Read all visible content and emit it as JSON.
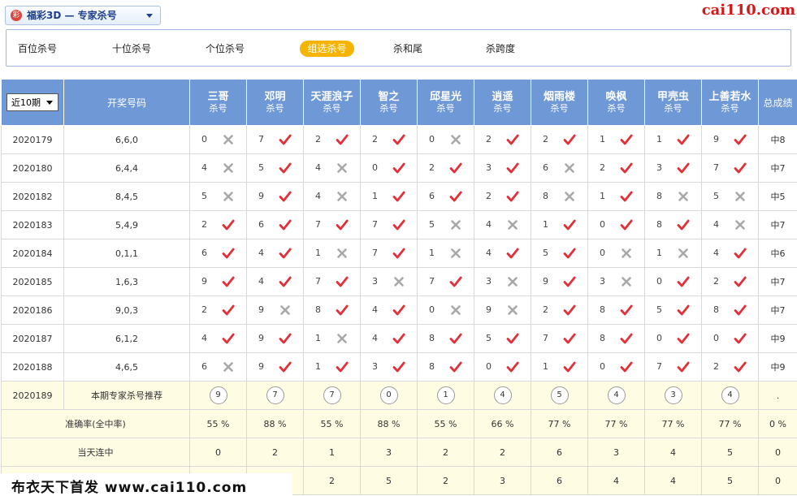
{
  "header": {
    "lottery_select": "福彩3D — 专家杀号",
    "logo_text": "彩",
    "site": "cai110.com"
  },
  "tabs": [
    {
      "label": "百位杀号",
      "active": false
    },
    {
      "label": "十位杀号",
      "active": false
    },
    {
      "label": "个位杀号",
      "active": false
    },
    {
      "label": "组选杀号",
      "active": true
    },
    {
      "label": "杀和尾",
      "active": false
    },
    {
      "label": "杀跨度",
      "active": false
    }
  ],
  "table": {
    "period_select": "近10期",
    "draw_col": "开奖号码",
    "total_col": "总成绩",
    "experts": [
      {
        "name": "三哥",
        "sub": "杀号"
      },
      {
        "name": "邓明",
        "sub": "杀号"
      },
      {
        "name": "天涯浪子",
        "sub": "杀号"
      },
      {
        "name": "智之",
        "sub": "杀号"
      },
      {
        "name": "邱星光",
        "sub": "杀号"
      },
      {
        "name": "逍遥",
        "sub": "杀号"
      },
      {
        "name": "烟雨楼",
        "sub": "杀号"
      },
      {
        "name": "唤枫",
        "sub": "杀号"
      },
      {
        "name": "甲壳虫",
        "sub": "杀号"
      },
      {
        "name": "上善若水",
        "sub": "杀号"
      }
    ],
    "rows": [
      {
        "period": "2020179",
        "draw": "6,6,0",
        "picks": [
          [
            "0",
            "x"
          ],
          [
            "7",
            "v"
          ],
          [
            "2",
            "v"
          ],
          [
            "2",
            "v"
          ],
          [
            "0",
            "x"
          ],
          [
            "2",
            "v"
          ],
          [
            "2",
            "v"
          ],
          [
            "1",
            "v"
          ],
          [
            "1",
            "v"
          ],
          [
            "9",
            "v"
          ]
        ],
        "total": "中8"
      },
      {
        "period": "2020180",
        "draw": "6,4,4",
        "picks": [
          [
            "4",
            "x"
          ],
          [
            "5",
            "v"
          ],
          [
            "4",
            "x"
          ],
          [
            "0",
            "v"
          ],
          [
            "2",
            "v"
          ],
          [
            "3",
            "v"
          ],
          [
            "6",
            "x"
          ],
          [
            "2",
            "v"
          ],
          [
            "3",
            "v"
          ],
          [
            "7",
            "v"
          ]
        ],
        "total": "中7"
      },
      {
        "period": "2020182",
        "draw": "8,4,5",
        "picks": [
          [
            "5",
            "x"
          ],
          [
            "9",
            "v"
          ],
          [
            "4",
            "x"
          ],
          [
            "1",
            "v"
          ],
          [
            "6",
            "v"
          ],
          [
            "2",
            "v"
          ],
          [
            "8",
            "x"
          ],
          [
            "1",
            "v"
          ],
          [
            "8",
            "x"
          ],
          [
            "5",
            "x"
          ]
        ],
        "total": "中5"
      },
      {
        "period": "2020183",
        "draw": "5,4,9",
        "picks": [
          [
            "2",
            "v"
          ],
          [
            "6",
            "v"
          ],
          [
            "7",
            "v"
          ],
          [
            "7",
            "v"
          ],
          [
            "5",
            "x"
          ],
          [
            "4",
            "x"
          ],
          [
            "1",
            "v"
          ],
          [
            "0",
            "v"
          ],
          [
            "8",
            "v"
          ],
          [
            "4",
            "x"
          ]
        ],
        "total": "中7"
      },
      {
        "period": "2020184",
        "draw": "0,1,1",
        "picks": [
          [
            "6",
            "v"
          ],
          [
            "4",
            "v"
          ],
          [
            "1",
            "x"
          ],
          [
            "7",
            "v"
          ],
          [
            "1",
            "x"
          ],
          [
            "4",
            "v"
          ],
          [
            "5",
            "v"
          ],
          [
            "0",
            "x"
          ],
          [
            "1",
            "x"
          ],
          [
            "4",
            "v"
          ]
        ],
        "total": "中6"
      },
      {
        "period": "2020185",
        "draw": "1,6,3",
        "picks": [
          [
            "9",
            "v"
          ],
          [
            "4",
            "v"
          ],
          [
            "7",
            "v"
          ],
          [
            "3",
            "x"
          ],
          [
            "7",
            "v"
          ],
          [
            "3",
            "x"
          ],
          [
            "9",
            "v"
          ],
          [
            "3",
            "x"
          ],
          [
            "0",
            "v"
          ],
          [
            "2",
            "v"
          ]
        ],
        "total": "中7"
      },
      {
        "period": "2020186",
        "draw": "9,0,3",
        "picks": [
          [
            "2",
            "v"
          ],
          [
            "9",
            "x"
          ],
          [
            "8",
            "v"
          ],
          [
            "4",
            "v"
          ],
          [
            "0",
            "x"
          ],
          [
            "9",
            "x"
          ],
          [
            "2",
            "v"
          ],
          [
            "8",
            "v"
          ],
          [
            "5",
            "v"
          ],
          [
            "8",
            "v"
          ]
        ],
        "total": "中7"
      },
      {
        "period": "2020187",
        "draw": "6,1,2",
        "picks": [
          [
            "4",
            "v"
          ],
          [
            "9",
            "v"
          ],
          [
            "1",
            "x"
          ],
          [
            "4",
            "v"
          ],
          [
            "8",
            "v"
          ],
          [
            "5",
            "v"
          ],
          [
            "7",
            "v"
          ],
          [
            "8",
            "v"
          ],
          [
            "0",
            "v"
          ],
          [
            "0",
            "v"
          ]
        ],
        "total": "中9"
      },
      {
        "period": "2020188",
        "draw": "4,6,5",
        "picks": [
          [
            "6",
            "x"
          ],
          [
            "9",
            "v"
          ],
          [
            "1",
            "v"
          ],
          [
            "3",
            "v"
          ],
          [
            "8",
            "v"
          ],
          [
            "0",
            "v"
          ],
          [
            "1",
            "v"
          ],
          [
            "0",
            "v"
          ],
          [
            "7",
            "v"
          ],
          [
            "2",
            "v"
          ]
        ],
        "total": "中9"
      }
    ],
    "recommend": {
      "period": "2020189",
      "label": "本期专家杀号推荐",
      "values": [
        "9",
        "7",
        "7",
        "0",
        "1",
        "4",
        "5",
        "4",
        "3",
        "4"
      ],
      "total": "."
    },
    "accuracy": {
      "label": "准确率(全中率)",
      "values": [
        "55 %",
        "88 %",
        "55 %",
        "88 %",
        "55 %",
        "66 %",
        "77 %",
        "77 %",
        "77 %",
        "77 %"
      ],
      "total": "0 %"
    },
    "streak": {
      "label": "当天连中",
      "values": [
        "0",
        "2",
        "1",
        "3",
        "2",
        "2",
        "6",
        "3",
        "4",
        "5"
      ],
      "total": "0"
    },
    "maxstreak": {
      "values": [
        "",
        "",
        "2",
        "5",
        "2",
        "3",
        "6",
        "4",
        "4",
        "5"
      ],
      "total": "0"
    }
  },
  "footer": {
    "watermark": "布衣天下首发 www.cai110.com"
  },
  "colors": {
    "header_blue": "#6f98d6",
    "hit_red": "#e0303a",
    "miss_gray": "#a8a8a8",
    "active_tab": "#f4b400",
    "light_yellow": "#fffce4"
  }
}
